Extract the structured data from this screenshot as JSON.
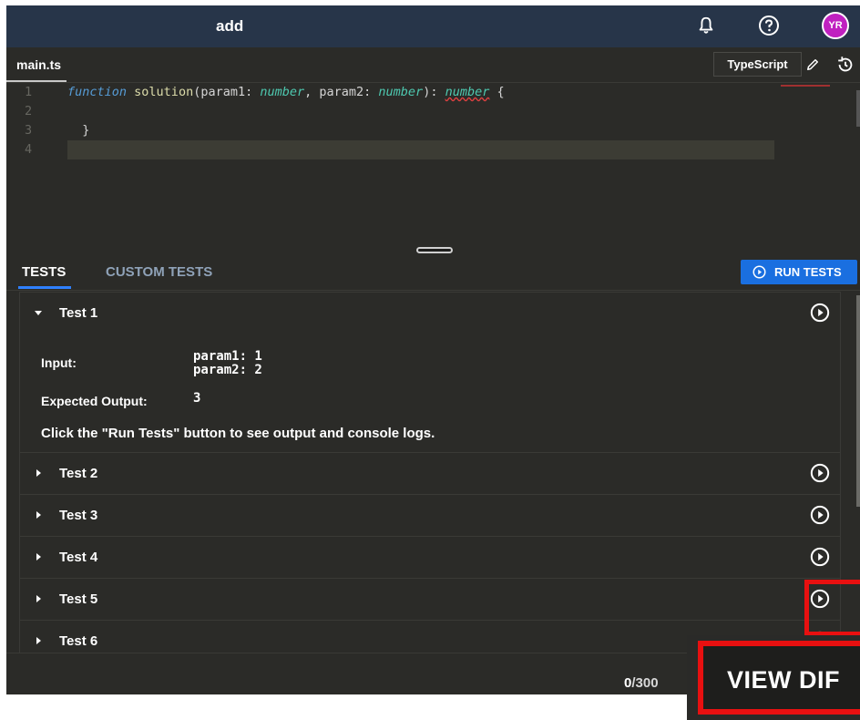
{
  "header": {
    "title": "add",
    "avatar_initials": "YR",
    "avatar_color": "#c020c0"
  },
  "file": {
    "name": "main.ts",
    "language": "TypeScript"
  },
  "editor": {
    "line_numbers": [
      "1",
      "2",
      "3",
      "4"
    ],
    "line1": {
      "kw": "function",
      "fn": "solution",
      "p1": "(param1: ",
      "t1": "number",
      "p2": ", param2: ",
      "t2": "number",
      "p3": "): ",
      "t3": "number",
      "p4": " {"
    },
    "line3": "}"
  },
  "tabs": {
    "tests": "TESTS",
    "custom": "CUSTOM TESTS",
    "run": "RUN TESTS"
  },
  "test1": {
    "name": "Test 1",
    "input_label": "Input:",
    "input_line1": "param1: 1",
    "input_line2": "param2: 2",
    "expected_label": "Expected Output:",
    "expected_value": "3",
    "hint": "Click the \"Run Tests\" button to see output and console logs."
  },
  "tests": [
    "Test 2",
    "Test 3",
    "Test 4",
    "Test 5",
    "Test 6"
  ],
  "footer": {
    "counter_value": "0",
    "counter_total": "/300",
    "view_diff": "VIEW DIF"
  },
  "colors": {
    "accent": "#1a6fe0",
    "highlight": "#e81010",
    "topbar": "#273549"
  }
}
